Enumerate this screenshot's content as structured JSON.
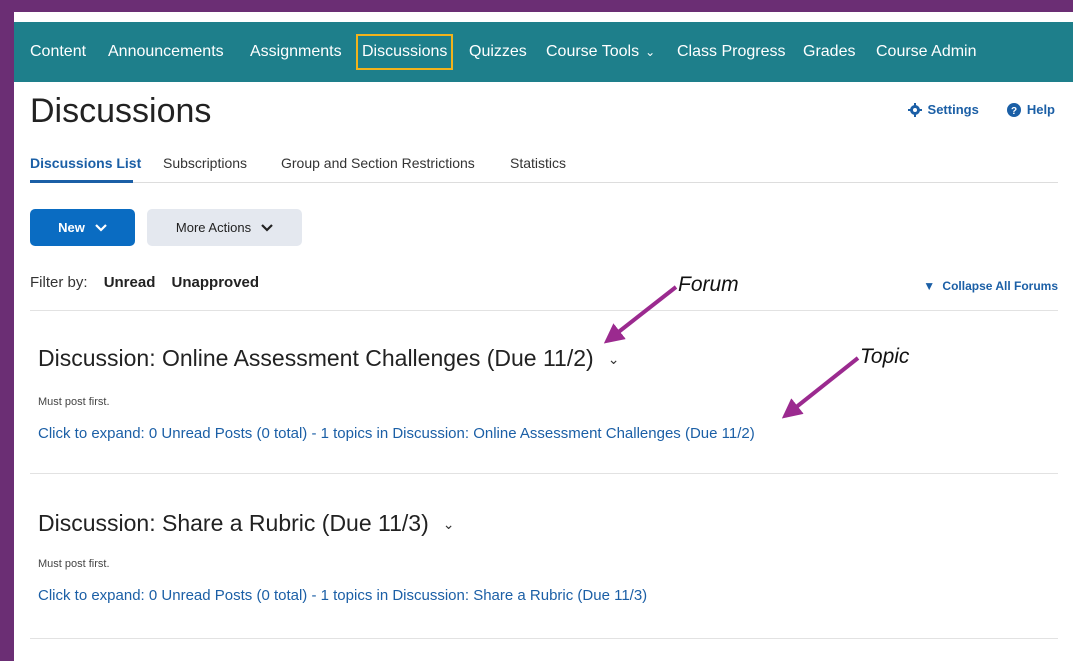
{
  "nav": {
    "items": [
      {
        "label": "Content"
      },
      {
        "label": "Announcements"
      },
      {
        "label": "Assignments"
      },
      {
        "label": "Discussions"
      },
      {
        "label": "Quizzes"
      },
      {
        "label": "Course Tools"
      },
      {
        "label": "Class Progress"
      },
      {
        "label": "Grades"
      },
      {
        "label": "Course Admin"
      }
    ]
  },
  "page": {
    "title": "Discussions",
    "settings_label": "Settings",
    "help_label": "Help"
  },
  "tabs": [
    {
      "label": "Discussions List"
    },
    {
      "label": "Subscriptions"
    },
    {
      "label": "Group and Section Restrictions"
    },
    {
      "label": "Statistics"
    }
  ],
  "buttons": {
    "new_label": "New",
    "more_actions_label": "More Actions"
  },
  "filter": {
    "label": "Filter by:",
    "unread": "Unread",
    "unapproved": "Unapproved",
    "collapse_all": "Collapse All Forums"
  },
  "forums": [
    {
      "title": "Discussion: Online Assessment Challenges (Due 11/2)",
      "note": "Must post first.",
      "expand": "Click to expand: 0 Unread Posts (0 total) - 1 topics in Discussion: Online Assessment Challenges (Due 11/2)"
    },
    {
      "title": "Discussion: Share a Rubric (Due 11/3)",
      "note": "Must post first.",
      "expand": "Click to expand: 0 Unread Posts (0 total) - 1 topics in Discussion: Share a Rubric (Due 11/3)"
    }
  ],
  "annotations": {
    "forum": "Forum",
    "topic": "Topic",
    "arrow_color": "#9b2a8f"
  },
  "colors": {
    "frame": "#6b2e74",
    "nav_bg": "#1e7f8b",
    "active_outline": "#f2b31b",
    "link": "#1b5fa6",
    "primary_button": "#0a6cc2"
  }
}
